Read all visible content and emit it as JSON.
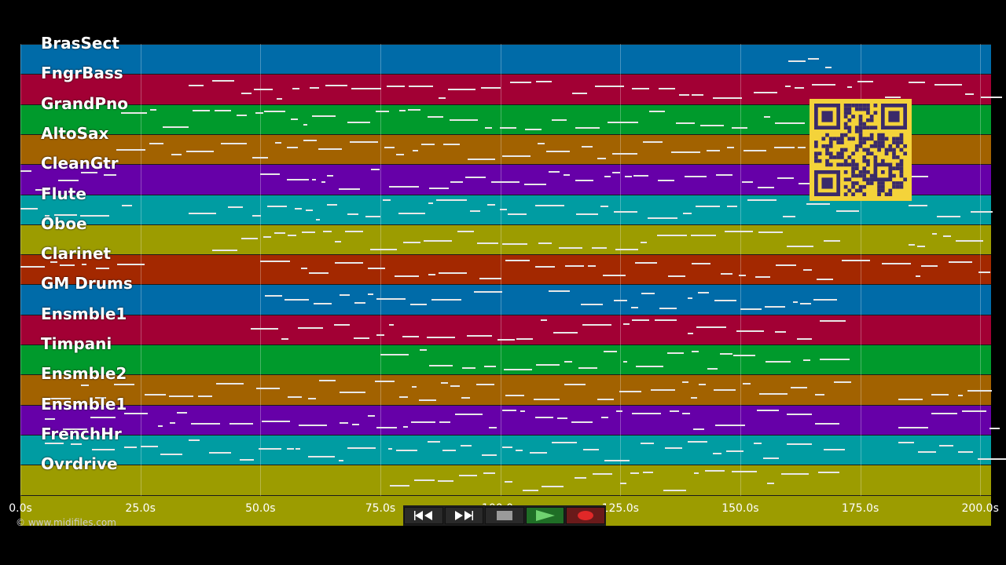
{
  "tracks": [
    {
      "name": "BrasSect",
      "color": "#006ba8"
    },
    {
      "name": "FngrBass",
      "color": "#a20034"
    },
    {
      "name": "GrandPno",
      "color": "#009a2c"
    },
    {
      "name": "AltoSax",
      "color": "#a26200"
    },
    {
      "name": "CleanGtr",
      "color": "#6600a8"
    },
    {
      "name": "Flute",
      "color": "#009ca2"
    },
    {
      "name": "Oboe",
      "color": "#9c9c00"
    },
    {
      "name": "Clarinet",
      "color": "#a32800"
    },
    {
      "name": "GM Drums",
      "color": "#006ba8"
    },
    {
      "name": "Ensmble1",
      "color": "#a20034"
    },
    {
      "name": "Timpani",
      "color": "#009a2c"
    },
    {
      "name": "Ensmble2",
      "color": "#a26200"
    },
    {
      "name": "Ensmble1",
      "color": "#6600a8"
    },
    {
      "name": "FrenchHr",
      "color": "#009ca2"
    },
    {
      "name": "Ovrdrive",
      "color": "#9c9c00"
    },
    {
      "name": "",
      "color": "#9c9c00"
    }
  ],
  "timeline": {
    "ticks": [
      "0.0s",
      "25.0s",
      "50.0s",
      "75.0s",
      "100.0s",
      "125.0s",
      "150.0s",
      "175.0s",
      "200.0s"
    ],
    "max_seconds": 202
  },
  "copyright": "© www.midifiles.com",
  "transport": {
    "rewind_icon": "rewind-icon",
    "fast_forward_icon": "fast-forward-icon",
    "stop_icon": "stop-icon",
    "play_icon": "play-icon",
    "record_icon": "record-icon"
  },
  "colors": {
    "background": "#000000",
    "qr_background": "#f4d33a",
    "qr_module": "#3a2a6a"
  }
}
